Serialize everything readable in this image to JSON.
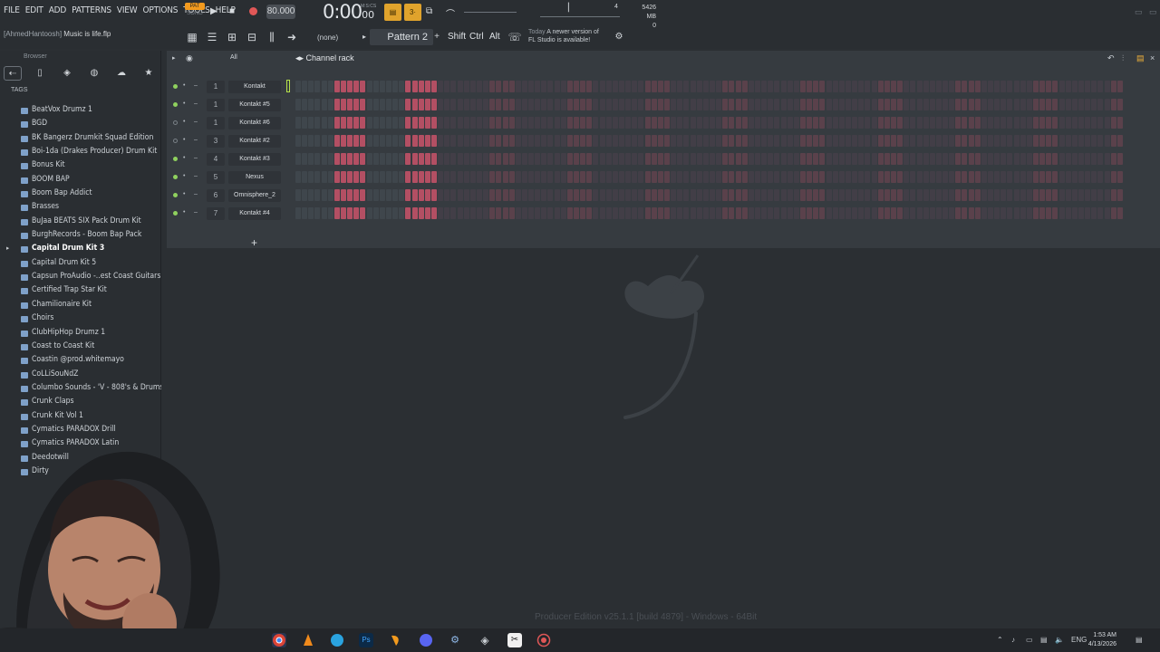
{
  "menu": [
    "FILE",
    "EDIT",
    "ADD",
    "PATTERNS",
    "VIEW",
    "OPTIONS",
    "TOOLS",
    "HELP"
  ],
  "transport": {
    "pat_label": "PAT",
    "song_label": "SONG",
    "tempo": "80.000",
    "time_main": "0:00",
    "time_sub": "00",
    "time_unit": "M:S:CS",
    "memory": "5426 MB",
    "cpu_num": "4",
    "poly": "0"
  },
  "project": {
    "user": "[AhmedHantoosh]",
    "file": "Music is life.flp"
  },
  "toolbar": {
    "none_label": "(none)",
    "pattern": "Pattern 2",
    "shift": "Shift",
    "ctrl": "Ctrl",
    "alt": "Alt",
    "news_day": "Today",
    "news_line1": "A newer version of",
    "news_line2": "FL Studio is available!"
  },
  "browser": {
    "title": "Browser",
    "tags_label": "TAGS",
    "folders": [
      "BeatVox Drumz 1",
      "BGD",
      "BK Bangerz Drumkit Squad Edition",
      "Boi-1da (Drakes Producer) Drum Kit",
      "Bonus Kit",
      "BOOM BAP",
      "Boom Bap Addict",
      "Brasses",
      "BuJaa BEATS SIX Pack Drum Kit",
      "BurghRecords - Boom Bap Pack",
      "Capital Drum Kit 3",
      "Capital Drum Kit 5",
      "Capsun ProAudio -..est Coast Guitars",
      "Certified Trap Star Kit",
      "Chamilionaire Kit",
      "Choirs",
      "ClubHipHop Drumz 1",
      "Coast to Coast Kit",
      "Coastin @prod.whitemayo",
      "CoLLiSouNdZ",
      "Columbo Sounds - 'V - 808's & Drums",
      "Crunk Claps",
      "Crunk Kit Vol 1",
      "Cymatics PARADOX Drill",
      "Cymatics PARADOX Latin",
      "Deedotwill",
      "Dirty"
    ],
    "selected_index": 10
  },
  "channel_rack": {
    "title": "Channel rack",
    "filter": "All",
    "channels": [
      {
        "num": "1",
        "name": "Kontakt",
        "on": true
      },
      {
        "num": "1",
        "name": "Kontakt #5",
        "on": true
      },
      {
        "num": "1",
        "name": "Kontakt #6",
        "on": false
      },
      {
        "num": "3",
        "name": "Kontakt #2",
        "on": false
      },
      {
        "num": "4",
        "name": "Kontakt #3",
        "on": true
      },
      {
        "num": "5",
        "name": "Nexus",
        "on": true
      },
      {
        "num": "6",
        "name": "Omnisphere_2",
        "on": true
      },
      {
        "num": "7",
        "name": "Kontakt #4",
        "on": true
      }
    ],
    "add_label": "+"
  },
  "workspace": {
    "edition": "Producer Edition v25.1.1 [build 4879] - Windows - 64Bit"
  },
  "taskbar": {
    "lang": "ENG",
    "time": "1:53 AM",
    "date": "4/13/2026"
  },
  "colors": {
    "accent_orange": "#f29a1e",
    "step_red": "#c9536a",
    "led_green": "#8fd15e",
    "folder_blue": "#7fa1c9"
  }
}
